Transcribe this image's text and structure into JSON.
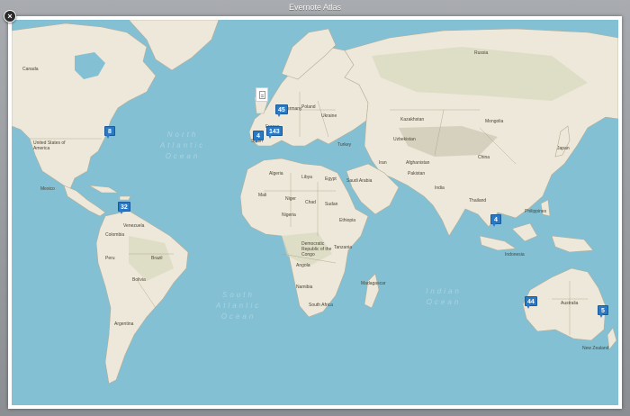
{
  "window": {
    "title": "Evernote Atlas"
  },
  "close_label": "×",
  "map": {
    "countries": [
      {
        "key": "canada",
        "label": "Canada"
      },
      {
        "key": "usa",
        "label": "United States of America"
      },
      {
        "key": "mexico",
        "label": "Mexico"
      },
      {
        "key": "brazil",
        "label": "Brazil"
      },
      {
        "key": "bolivia",
        "label": "Bolivia"
      },
      {
        "key": "argentina",
        "label": "Argentina"
      },
      {
        "key": "peru",
        "label": "Peru"
      },
      {
        "key": "venezuela",
        "label": "Venezuela"
      },
      {
        "key": "colombia",
        "label": "Colombia"
      },
      {
        "key": "russia",
        "label": "Russia"
      },
      {
        "key": "kazakhstan",
        "label": "Kazakhstan"
      },
      {
        "key": "mongolia",
        "label": "Mongolia"
      },
      {
        "key": "china",
        "label": "China"
      },
      {
        "key": "india",
        "label": "India"
      },
      {
        "key": "iran",
        "label": "Iran"
      },
      {
        "key": "saudi",
        "label": "Saudi Arabia"
      },
      {
        "key": "egypt",
        "label": "Egypt"
      },
      {
        "key": "libya",
        "label": "Libya"
      },
      {
        "key": "algeria",
        "label": "Algeria"
      },
      {
        "key": "mali",
        "label": "Mali"
      },
      {
        "key": "niger",
        "label": "Niger"
      },
      {
        "key": "chad",
        "label": "Chad"
      },
      {
        "key": "sudan",
        "label": "Sudan"
      },
      {
        "key": "ethiopia",
        "label": "Ethiopia"
      },
      {
        "key": "nigeria",
        "label": "Nigeria"
      },
      {
        "key": "drc",
        "label": "Democratic Republic of the Congo"
      },
      {
        "key": "tanzania",
        "label": "Tanzania"
      },
      {
        "key": "angola",
        "label": "Angola"
      },
      {
        "key": "namibia",
        "label": "Namibia"
      },
      {
        "key": "southafrica",
        "label": "South Africa"
      },
      {
        "key": "madagascar",
        "label": "Madagascar"
      },
      {
        "key": "turkey",
        "label": "Turkey"
      },
      {
        "key": "france",
        "label": "France"
      },
      {
        "key": "spain",
        "label": "Spain"
      },
      {
        "key": "germany",
        "label": "Germany"
      },
      {
        "key": "poland",
        "label": "Poland"
      },
      {
        "key": "ukraine",
        "label": "Ukraine"
      },
      {
        "key": "uzbekistan",
        "label": "Uzbekistan"
      },
      {
        "key": "afghanistan",
        "label": "Afghanistan"
      },
      {
        "key": "pakistan",
        "label": "Pakistan"
      },
      {
        "key": "thailand",
        "label": "Thailand"
      },
      {
        "key": "indonesia",
        "label": "Indonesia"
      },
      {
        "key": "philippines",
        "label": "Philippines"
      },
      {
        "key": "japan",
        "label": "Japan"
      },
      {
        "key": "australia",
        "label": "Australia"
      },
      {
        "key": "newzealand",
        "label": "New Zealand"
      }
    ],
    "oceans": [
      {
        "key": "north-atlantic",
        "label": "North Atlantic Ocean"
      },
      {
        "key": "south-atlantic",
        "label": "South Atlantic Ocean"
      },
      {
        "key": "indian",
        "label": "Indian Ocean"
      }
    ],
    "markers": [
      {
        "key": "new-york",
        "count": "8"
      },
      {
        "key": "caribbean",
        "count": "32"
      },
      {
        "key": "london",
        "count": "45"
      },
      {
        "key": "spain",
        "count": "4"
      },
      {
        "key": "mediterranean",
        "count": "143"
      },
      {
        "key": "thailand",
        "count": "4"
      },
      {
        "key": "perth",
        "count": "44"
      },
      {
        "key": "sydney",
        "count": "5"
      }
    ],
    "note_marker": {
      "icon": "document-icon"
    }
  }
}
